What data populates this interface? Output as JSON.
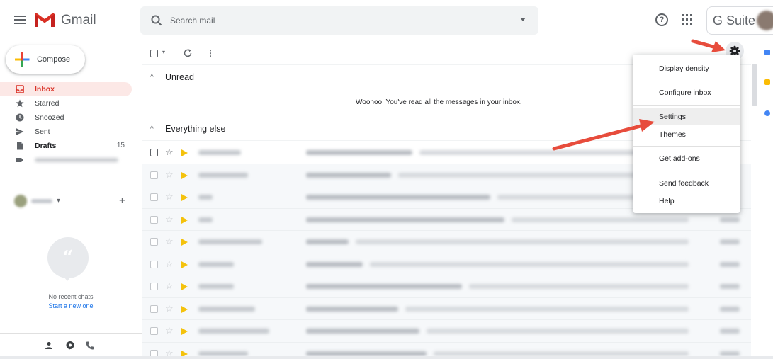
{
  "header": {
    "app_name": "Gmail",
    "search_placeholder": "Search mail",
    "help_glyph": "?",
    "suite_label": "G Suite"
  },
  "sidebar": {
    "compose_label": "Compose",
    "items": [
      {
        "label": "Inbox",
        "icon": "inbox-icon",
        "active": true,
        "count": ""
      },
      {
        "label": "Starred",
        "icon": "star-icon",
        "count": ""
      },
      {
        "label": "Snoozed",
        "icon": "clock-icon",
        "count": ""
      },
      {
        "label": "Sent",
        "icon": "send-icon",
        "count": ""
      },
      {
        "label": "Drafts",
        "icon": "draft-icon",
        "count": "15"
      },
      {
        "label": "",
        "icon": "label-icon",
        "count": ""
      }
    ],
    "hangouts": {
      "add_glyph": "+",
      "no_chats": "No recent chats",
      "start_chat": "Start a new one"
    }
  },
  "toolbar": {
    "more_glyph": "⋮"
  },
  "sections": {
    "unread_title": "Unread",
    "empty_message": "Woohoo! You've read all the messages in your inbox.",
    "everything_title": "Everything else"
  },
  "settings_menu": {
    "items": [
      "Display density",
      "Configure inbox",
      "Settings",
      "Themes",
      "Get add-ons",
      "Send feedback",
      "Help"
    ],
    "highlighted": "Settings"
  },
  "colors": {
    "gmail_red": "#d93025",
    "important_marker": "#f4c20d",
    "annotation_arrow": "#e74c3c",
    "link_blue": "#1a73e8"
  },
  "email_rows_count_visible": 10
}
